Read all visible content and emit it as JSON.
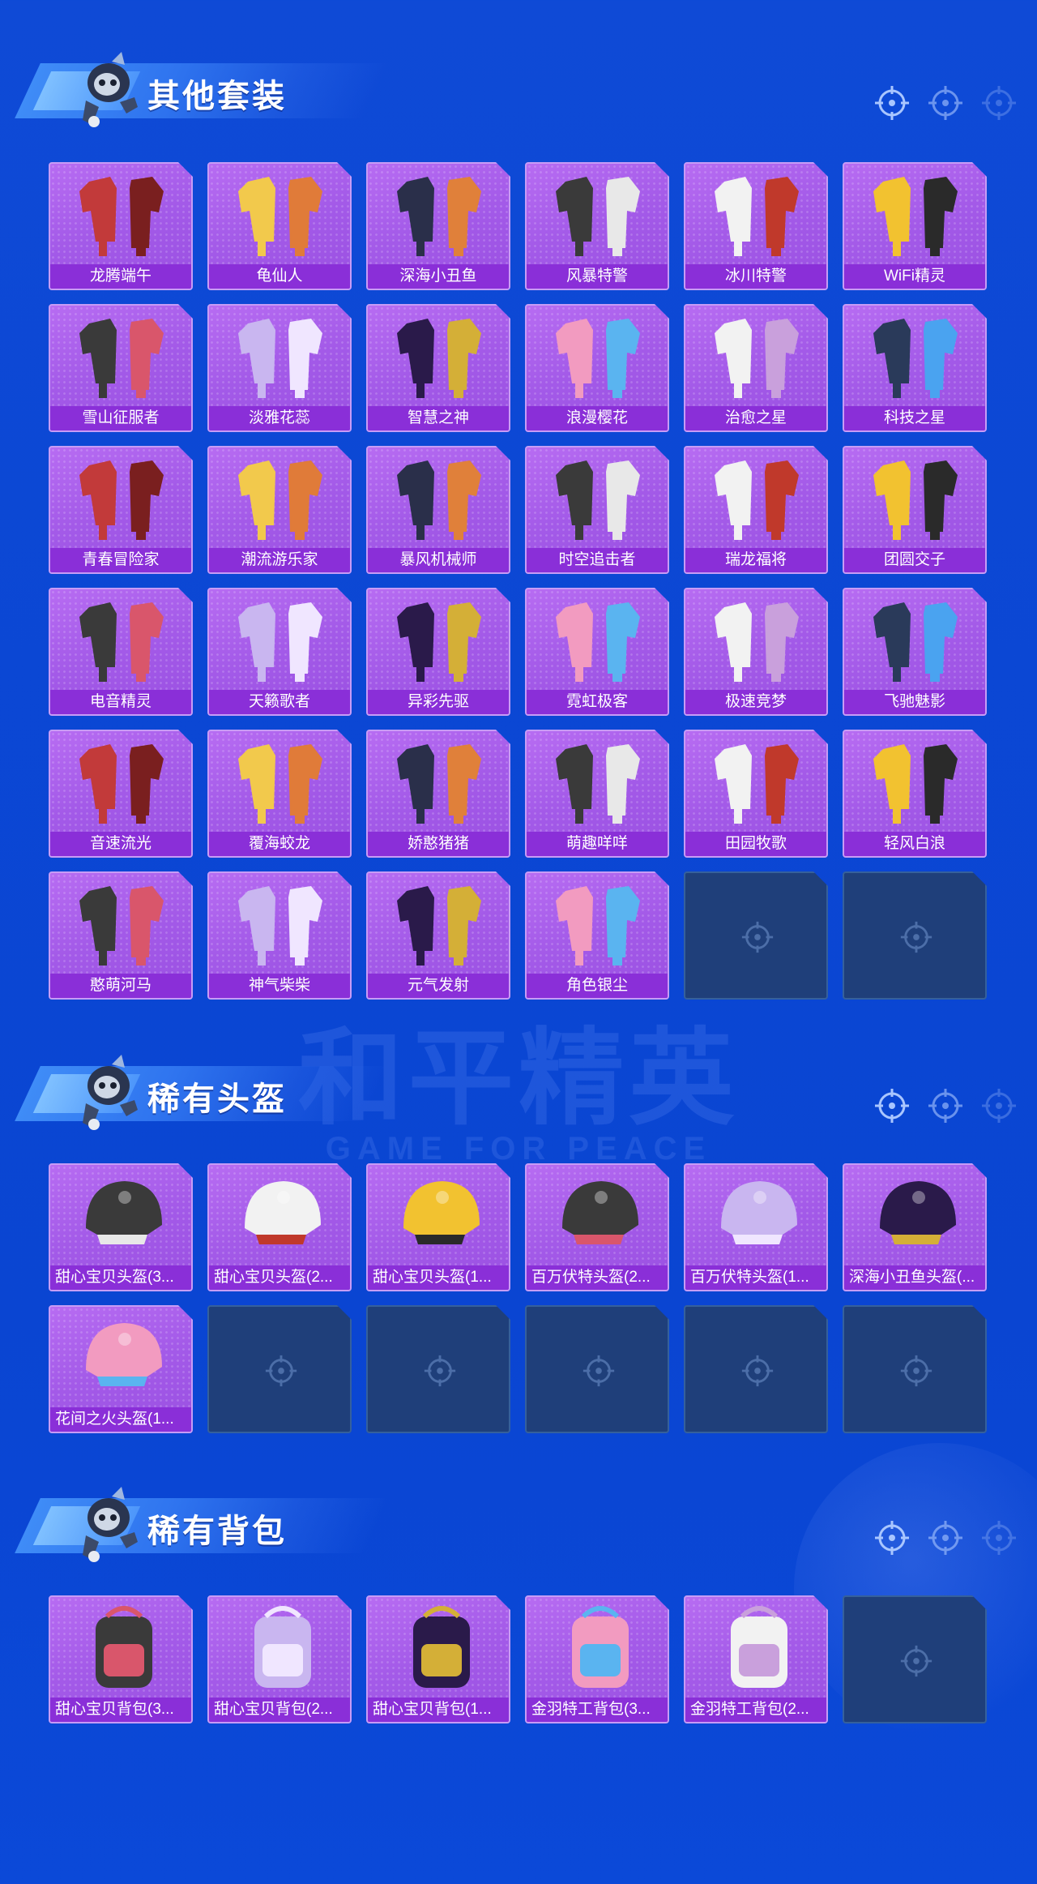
{
  "colors": {
    "background": "#0b47d4",
    "card_bg": "#a35ae8",
    "card_label_bg": "#8a2fd8",
    "card_border": "#c79cf6",
    "empty_slot": "#1f3f7a"
  },
  "watermark": {
    "title": "和平精英",
    "subtitle": "GAME FOR PEACE"
  },
  "sections": [
    {
      "title": "其他套装",
      "items": [
        "龙腾端午",
        "龟仙人",
        "深海小丑鱼",
        "风暴特警",
        "冰川特警",
        "WiFi精灵",
        "雪山征服者",
        "淡雅花蕊",
        "智慧之神",
        "浪漫樱花",
        "治愈之星",
        "科技之星",
        "青春冒险家",
        "潮流游乐家",
        "暴风机械师",
        "时空追击者",
        "瑞龙福将",
        "团圆交子",
        "电音精灵",
        "天籁歌者",
        "异彩先驱",
        "霓虹极客",
        "极速竞梦",
        "飞驰魅影",
        "音速流光",
        "覆海蛟龙",
        "娇憨猪猪",
        "萌趣咩咩",
        "田园牧歌",
        "轻风白浪",
        "憨萌河马",
        "神气柴柴",
        "元气发射",
        "角色银尘"
      ],
      "empty_slots": 2
    },
    {
      "title": "稀有头盔",
      "items": [
        "甜心宝贝头盔(3...",
        "甜心宝贝头盔(2...",
        "甜心宝贝头盔(1...",
        "百万伏特头盔(2...",
        "百万伏特头盔(1...",
        "深海小丑鱼头盔(...",
        "花间之火头盔(1..."
      ],
      "empty_slots": 5
    },
    {
      "title": "稀有背包",
      "items": [
        "甜心宝贝背包(3...",
        "甜心宝贝背包(2...",
        "甜心宝贝背包(1...",
        "金羽特工背包(3...",
        "金羽特工背包(2..."
      ],
      "empty_slots": 1
    }
  ]
}
